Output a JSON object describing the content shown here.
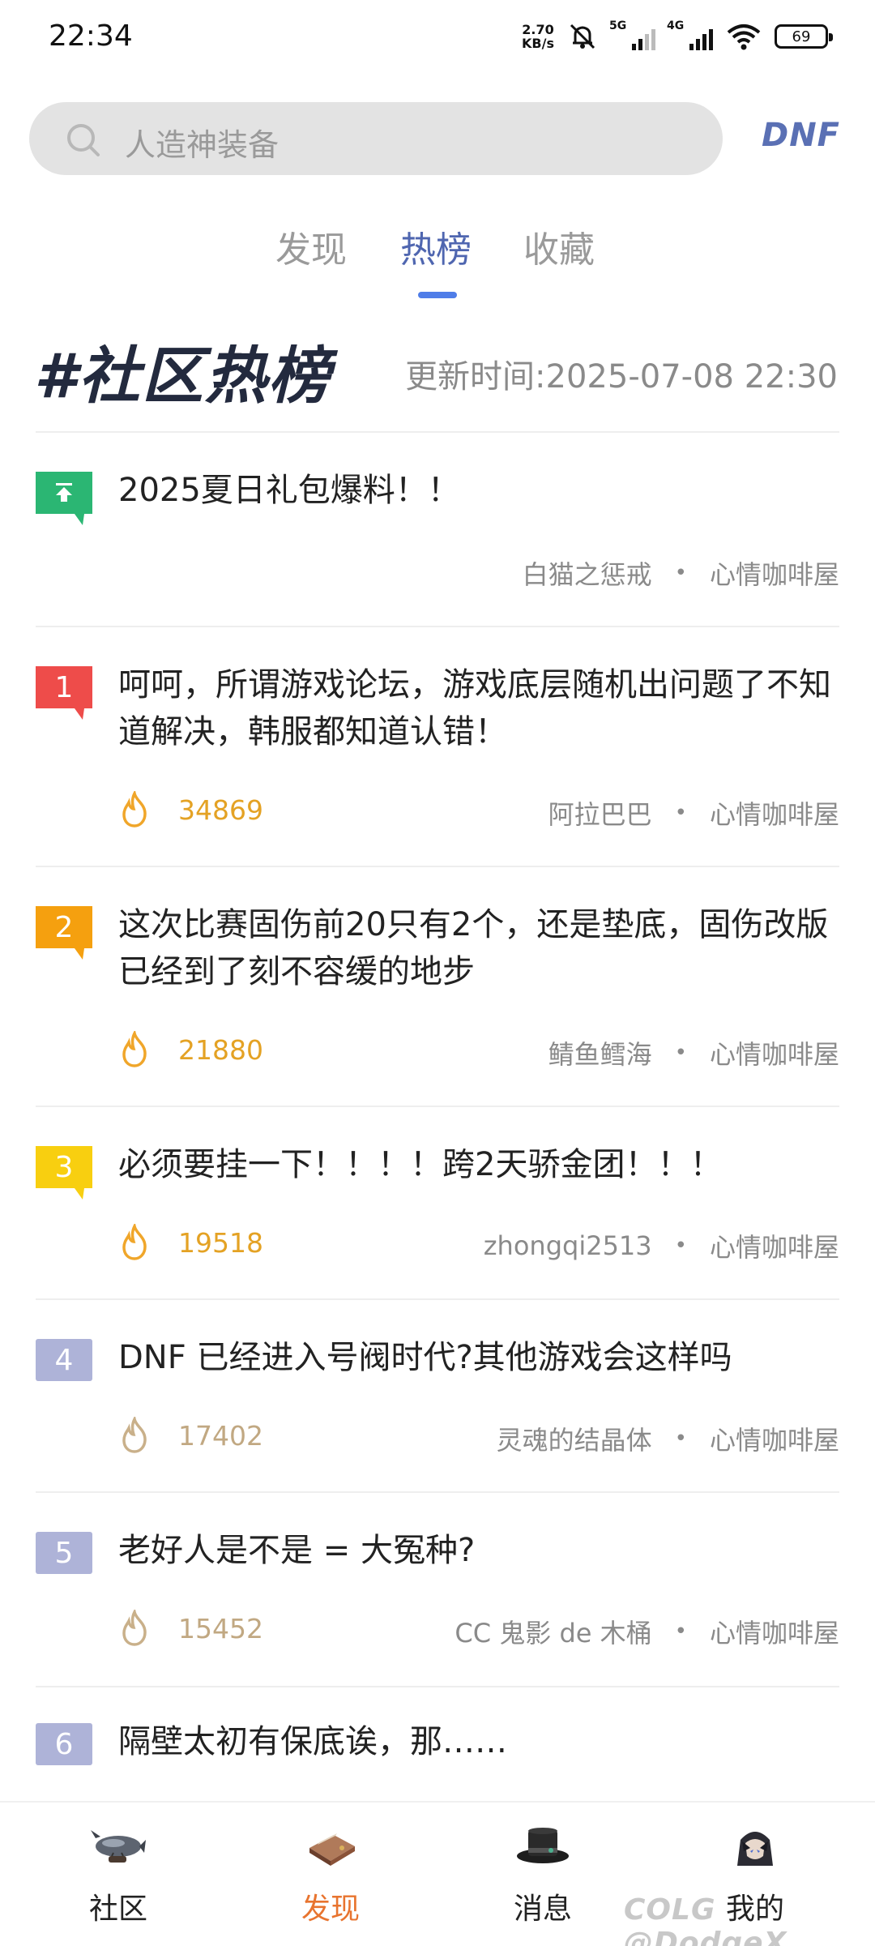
{
  "status_bar": {
    "time": "22:34",
    "net_speed_value": "2.70",
    "net_speed_unit": "KB/s",
    "signal1_label": "5G",
    "signal2_label": "4G",
    "battery": "69"
  },
  "search": {
    "placeholder": "人造神装备",
    "logo": "DNF"
  },
  "tabs": [
    {
      "label": "发现",
      "active": false
    },
    {
      "label": "热榜",
      "active": true
    },
    {
      "label": "收藏",
      "active": false
    }
  ],
  "header": {
    "title": "#社区热榜",
    "update_time": "更新时间:2025-07-08 22:30"
  },
  "items": [
    {
      "rank": "",
      "pinned": true,
      "title": "2025夏日礼包爆料！！",
      "heat": "",
      "author": "白猫之惩戒",
      "forum": "心情咖啡屋"
    },
    {
      "rank": "1",
      "title": "呵呵，所谓游戏论坛，游戏底层随机出问题了不知道解决，韩服都知道认错！",
      "heat": "34869",
      "author": "阿拉巴巴",
      "forum": "心情咖啡屋"
    },
    {
      "rank": "2",
      "title": "这次比赛固伤前20只有2个，还是垫底，固伤改版已经到了刻不容缓的地步",
      "heat": "21880",
      "author": "鲭鱼鳕海",
      "forum": "心情咖啡屋"
    },
    {
      "rank": "3",
      "title": "必须要挂一下！！！！跨2天骄金团！！！",
      "heat": "19518",
      "author": "zhongqi2513",
      "forum": "心情咖啡屋"
    },
    {
      "rank": "4",
      "title": "DNF 已经进入号阀时代?其他游戏会这样吗",
      "heat": "17402",
      "author": "灵魂的结晶体",
      "forum": "心情咖啡屋"
    },
    {
      "rank": "5",
      "title": "老好人是不是 = 大冤种?",
      "heat": "15452",
      "author": "CC 鬼影 de 木桶",
      "forum": "心情咖啡屋"
    },
    {
      "rank": "6",
      "title": "隔壁太初有保底诶，那……",
      "heat": "",
      "author": "",
      "forum": ""
    }
  ],
  "bottom_nav": [
    {
      "label": "社区",
      "icon": "airship-icon",
      "active": false
    },
    {
      "label": "发现",
      "icon": "book-icon",
      "active": true
    },
    {
      "label": "消息",
      "icon": "top-hat-icon",
      "active": false
    },
    {
      "label": "我的",
      "icon": "avatar-icon",
      "active": false
    }
  ],
  "watermark": "@DodgeX",
  "watermark_logo": "COLG",
  "colors": {
    "accent": "#4f66b0",
    "active_nav": "#e8742f",
    "rank1": "#ee4c4a",
    "rank2": "#f5a00f",
    "rank3": "#f8cf10",
    "rank_plain": "#aeb3d8",
    "pinned": "#2bb673"
  }
}
